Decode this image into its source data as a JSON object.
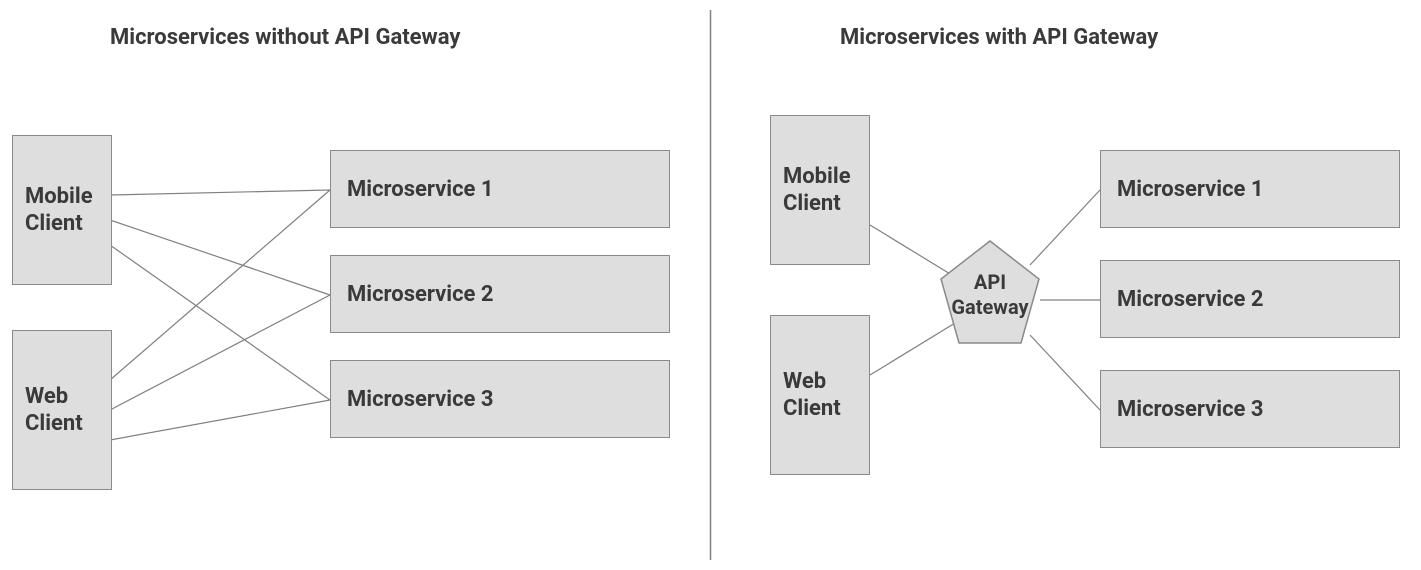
{
  "left": {
    "title": "Microservices without API Gateway",
    "clients": [
      "Mobile Client",
      "Web Client"
    ],
    "services": [
      "Microservice 1",
      "Microservice 2",
      "Microservice 3"
    ]
  },
  "right": {
    "title": "Microservices with API Gateway",
    "clients": [
      "Mobile Client",
      "Web Client"
    ],
    "gateway": "API Gateway",
    "services": [
      "Microservice 1",
      "Microservice 2",
      "Microservice 3"
    ]
  },
  "colors": {
    "box_fill": "#dedede",
    "box_border": "#8a8a8a",
    "line": "#808080",
    "text": "#3a3a3a"
  }
}
